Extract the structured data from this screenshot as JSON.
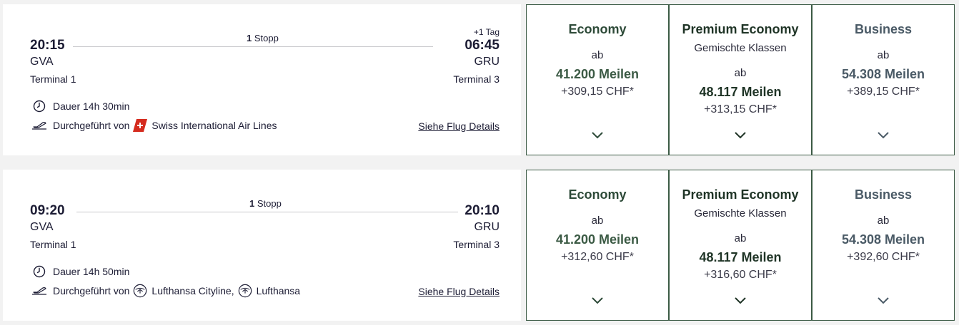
{
  "flights": [
    {
      "dep_time": "20:15",
      "arr_time": "06:45",
      "dep_airport": "GVA",
      "arr_airport": "GRU",
      "dep_terminal": "Terminal 1",
      "arr_terminal": "Terminal 3",
      "stops_count": "1",
      "stops_label": "Stopp",
      "plus_day": "+1 Tag",
      "duration": "Dauer 14h 30min",
      "operated_by": "Durchgeführt von",
      "airline": "Swiss International Air Lines",
      "airline_icon": "swiss-cross-icon",
      "details_link": "Siehe Flug Details",
      "cabins": [
        {
          "name": "Economy",
          "sub": "",
          "ab": "ab",
          "miles": "41.200 Meilen",
          "chf": "+309,15 CHF*"
        },
        {
          "name": "Premium Economy",
          "sub": "Gemischte Klassen",
          "ab": "ab",
          "miles": "48.117 Meilen",
          "chf": "+313,15 CHF*"
        },
        {
          "name": "Business",
          "sub": "",
          "ab": "ab",
          "miles": "54.308 Meilen",
          "chf": "+389,15 CHF*"
        }
      ]
    },
    {
      "dep_time": "09:20",
      "arr_time": "20:10",
      "dep_airport": "GVA",
      "arr_airport": "GRU",
      "dep_terminal": "Terminal 1",
      "arr_terminal": "Terminal 3",
      "stops_count": "1",
      "stops_label": "Stopp",
      "plus_day": "",
      "duration": "Dauer 14h 50min",
      "operated_by": "Durchgeführt von",
      "airline": "Lufthansa Cityline,",
      "airline2": "Lufthansa",
      "airline_icon": "lufthansa-crane-icon",
      "details_link": "Siehe Flug Details",
      "cabins": [
        {
          "name": "Economy",
          "sub": "",
          "ab": "ab",
          "miles": "41.200 Meilen",
          "chf": "+312,60 CHF*"
        },
        {
          "name": "Premium Economy",
          "sub": "Gemischte Klassen",
          "ab": "ab",
          "miles": "48.117 Meilen",
          "chf": "+316,60 CHF*"
        },
        {
          "name": "Business",
          "sub": "",
          "ab": "ab",
          "miles": "54.308 Meilen",
          "chf": "+392,60 CHF*"
        }
      ]
    }
  ],
  "colors": {
    "economy": "#3b5a44",
    "premium": "#1f3426",
    "business": "#4a5a66",
    "border": "#3b5a44",
    "swiss_red": "#d52b1e"
  }
}
